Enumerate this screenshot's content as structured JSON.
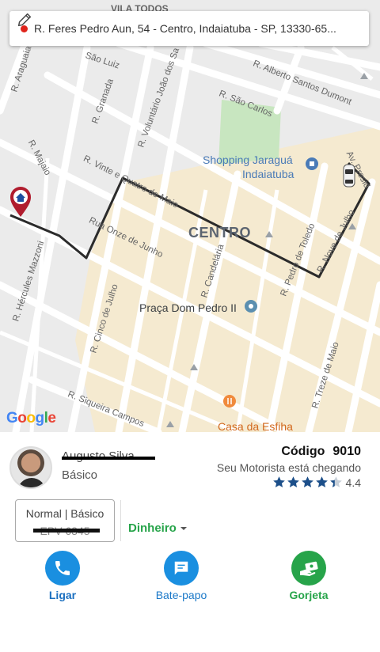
{
  "address_bar": {
    "text": "R. Feres Pedro Aun, 54 - Centro, Indaiatuba - SP, 13330-65..."
  },
  "map": {
    "top_partial_label": "VILA TODOS",
    "district": "CENTRO",
    "pois": {
      "shopping": [
        "Shopping Jaraguá",
        "Indaiatuba"
      ],
      "praca": "Praça Dom Pedro II",
      "casa_esfiha": "Casa da Esfiha"
    },
    "streets": {
      "araguaia": "R. Araguaia",
      "sao_luiz": "São Luiz",
      "granada": "R. Granada",
      "voluntario": "R. Voluntário João dos Sa",
      "alberto": "R. Alberto Santos Dumont",
      "sao_carlos": "R. São Carlos",
      "majaio": "R. Majaio",
      "vinte_quatro": "R. Vinte e Quatro de Maio",
      "onze_junho": "Rua Onze de Junho",
      "hercules": "R. Hércules Mazzoni",
      "cinco_julho": "R. Cinco de Julho",
      "candelaria": "R. Candelária",
      "pedro_toledo": "R. Pedro de Toledo",
      "nove_julho": "R. Nove de Julho",
      "treze_maio": "R. Treze de Maio",
      "siqueira": "R. Siqueira Campos",
      "av_presidente": "Av. Presid"
    },
    "google_letters": [
      "G",
      "o",
      "o",
      "g",
      "l",
      "e"
    ]
  },
  "driver": {
    "name": "Augusto Silva",
    "category": "Básico",
    "code_label": "Código",
    "code_value": "9010",
    "status": "Seu Motorista está chegando",
    "rating": 4.4,
    "rating_text": "4.4"
  },
  "vehicle": {
    "category": "Normal | Básico",
    "plate": "EPV 6345"
  },
  "payment": {
    "method": "Dinheiro"
  },
  "actions": [
    {
      "label": "Ligar",
      "icon": "phone-icon"
    },
    {
      "label": "Bate-papo",
      "icon": "chat-icon"
    },
    {
      "label": "Gorjeta",
      "icon": "tip-icon"
    }
  ],
  "colors": {
    "route": "#2b2b2b",
    "accent_blue": "#1a8fe0",
    "accent_green": "#27a44a",
    "star": "#1c4f8a"
  }
}
